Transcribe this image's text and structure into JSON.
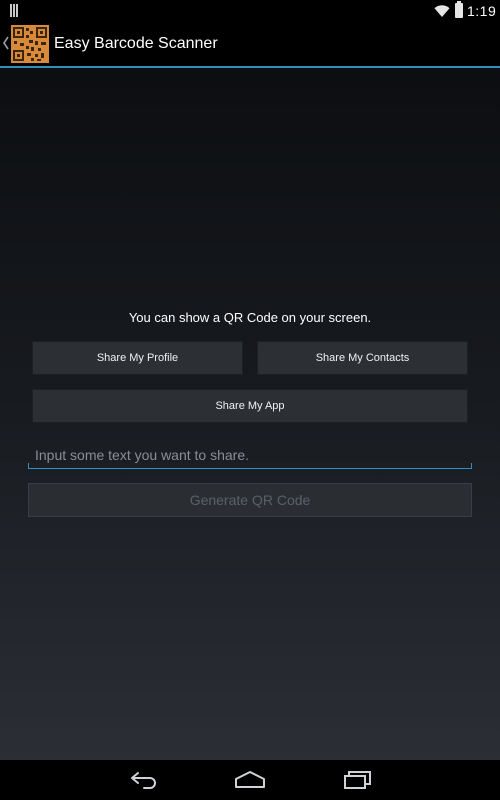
{
  "status_bar": {
    "time": "1:19",
    "icons": [
      "notification-icon",
      "wifi-icon",
      "battery-icon"
    ]
  },
  "action_bar": {
    "title": "Easy Barcode Scanner",
    "icons": [
      "up-caret-icon",
      "qr-code-logo-icon"
    ]
  },
  "main": {
    "info_text": "You can show a QR Code on your screen.",
    "buttons": {
      "share_profile": "Share My Profile",
      "share_contacts": "Share My Contacts",
      "share_app": "Share My App"
    },
    "input": {
      "value": "",
      "placeholder": "Input some text you want to share."
    },
    "generate_button": "Generate QR Code"
  },
  "nav_bar": {
    "icons": [
      "back-icon",
      "home-icon",
      "recents-icon"
    ]
  },
  "colors": {
    "accent": "#2f8fbd",
    "button_bg": "#2c3035",
    "disabled_text": "#5b6067",
    "logo_orange": "#d9893a"
  }
}
